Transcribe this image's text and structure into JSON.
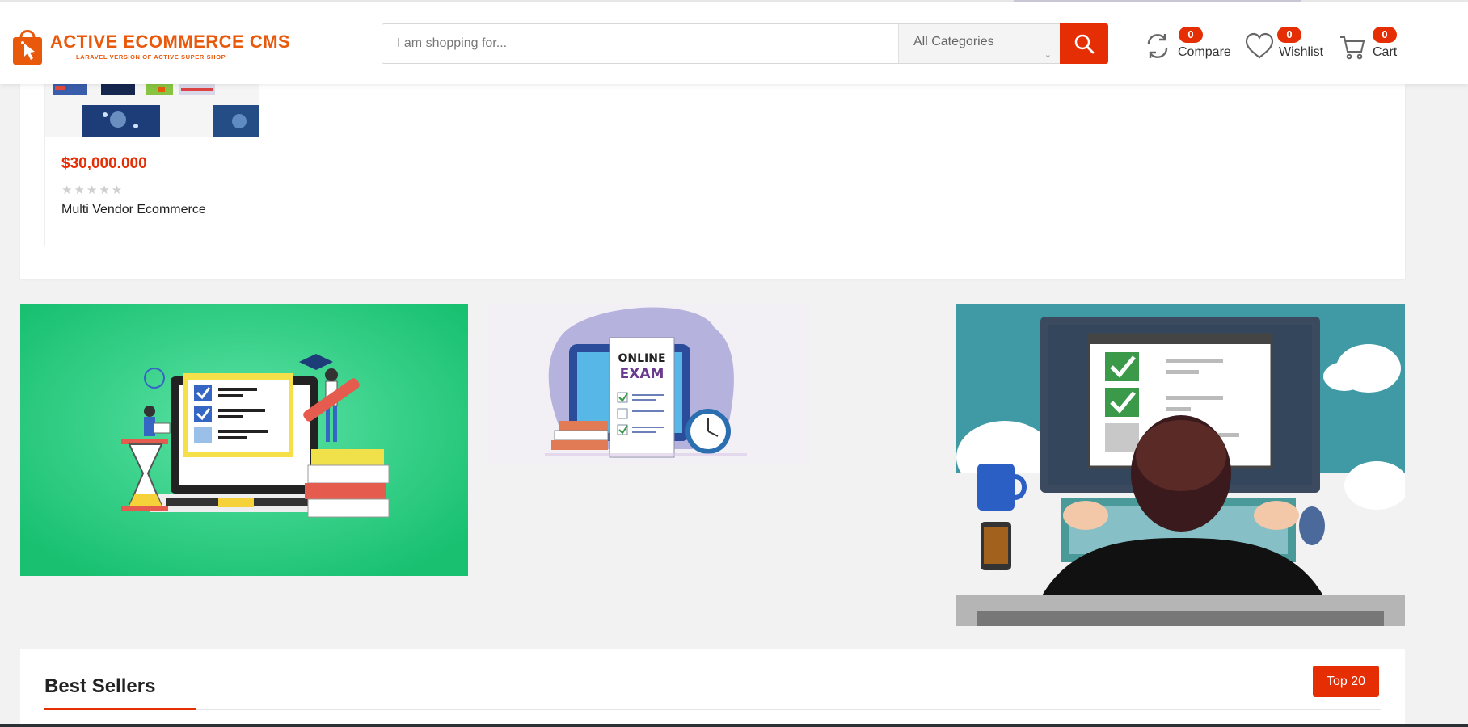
{
  "brand": {
    "name": "ACTIVE ECOMMERCE CMS",
    "tagline": "LARAVEL VERSION OF ACTIVE SUPER SHOP"
  },
  "search": {
    "placeholder": "I am shopping for...",
    "category_selected": "All Categories"
  },
  "header_actions": {
    "compare": {
      "label": "Compare",
      "count": "0"
    },
    "wishlist": {
      "label": "Wishlist",
      "count": "0"
    },
    "cart": {
      "label": "Cart",
      "count": "0"
    }
  },
  "product": {
    "price": "$30,000.000",
    "rating_stars": "★★★★★",
    "rating_value": 0,
    "name": "Multi Vendor Ecommerce"
  },
  "banners": {
    "middle": {
      "title_line1": "ONLINE",
      "title_line2": "EXAM"
    }
  },
  "best_sellers": {
    "title": "Best Sellers",
    "top_button": "Top 20"
  },
  "colors": {
    "accent": "#e62e04",
    "brand_orange": "#e8590c",
    "banner_green": "#1ec472",
    "banner_teal": "#3b9aa6"
  }
}
